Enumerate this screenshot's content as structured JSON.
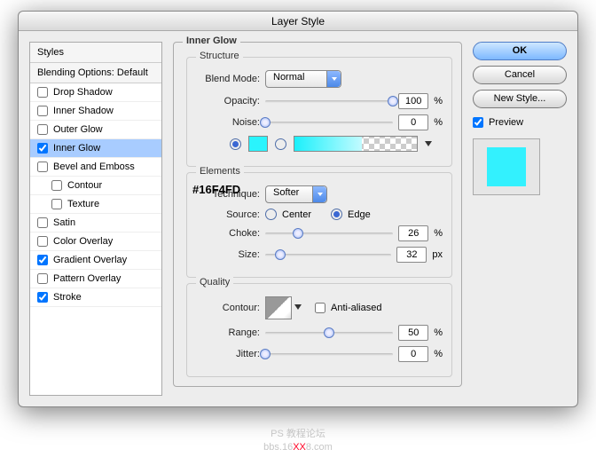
{
  "window": {
    "title": "Layer Style"
  },
  "sidebar": {
    "styles_header": "Styles",
    "blending_header": "Blending Options: Default",
    "items": [
      {
        "label": "Drop Shadow",
        "checked": false
      },
      {
        "label": "Inner Shadow",
        "checked": false
      },
      {
        "label": "Outer Glow",
        "checked": false
      },
      {
        "label": "Inner Glow",
        "checked": true,
        "selected": true
      },
      {
        "label": "Bevel and Emboss",
        "checked": false
      },
      {
        "label": "Contour",
        "checked": false,
        "indent": true
      },
      {
        "label": "Texture",
        "checked": false,
        "indent": true
      },
      {
        "label": "Satin",
        "checked": false
      },
      {
        "label": "Color Overlay",
        "checked": false
      },
      {
        "label": "Gradient Overlay",
        "checked": true
      },
      {
        "label": "Pattern Overlay",
        "checked": false
      },
      {
        "label": "Stroke",
        "checked": true
      }
    ]
  },
  "panel": {
    "title": "Inner Glow",
    "structure": {
      "legend": "Structure",
      "blend_mode_label": "Blend Mode:",
      "blend_mode_value": "Normal",
      "opacity_label": "Opacity:",
      "opacity_value": "100",
      "opacity_unit": "%",
      "noise_label": "Noise:",
      "noise_value": "0",
      "noise_unit": "%",
      "color_hex": "#16F4FD",
      "fill_source": "gradient"
    },
    "elements": {
      "legend": "Elements",
      "technique_label": "Technique:",
      "technique_value": "Softer",
      "source_label": "Source:",
      "source_center": "Center",
      "source_edge": "Edge",
      "source_value": "Edge",
      "choke_label": "Choke:",
      "choke_value": "26",
      "choke_unit": "%",
      "size_label": "Size:",
      "size_value": "32",
      "size_unit": "px"
    },
    "quality": {
      "legend": "Quality",
      "contour_label": "Contour:",
      "antialiased_label": "Anti-aliased",
      "antialiased": false,
      "range_label": "Range:",
      "range_value": "50",
      "range_unit": "%",
      "jitter_label": "Jitter:",
      "jitter_value": "0",
      "jitter_unit": "%"
    }
  },
  "buttons": {
    "ok": "OK",
    "cancel": "Cancel",
    "new_style": "New Style...",
    "preview_label": "Preview",
    "preview_checked": true
  },
  "annotation": {
    "color_label": "#16F4FD"
  },
  "footer_line1": "PS 教程论坛",
  "footer_domain": "bbs.16",
  "footer_xx": "XX",
  "footer_tld": "8.com"
}
